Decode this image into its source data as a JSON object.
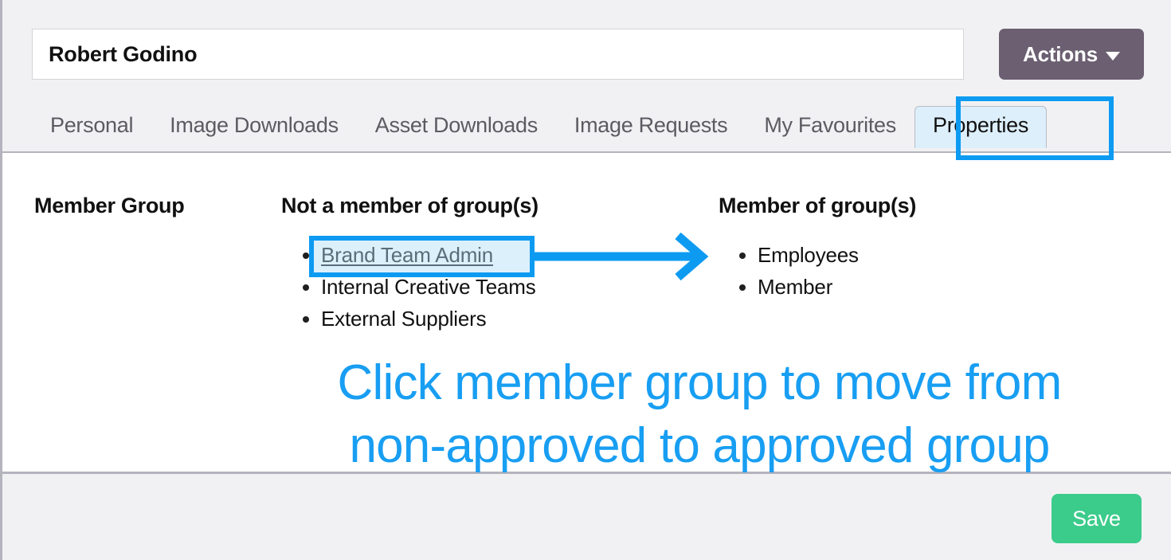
{
  "header": {
    "title_value": "Robert Godino",
    "title_placeholder": "Name",
    "actions_label": "Actions"
  },
  "tabs": [
    {
      "label": "Personal",
      "active": false
    },
    {
      "label": "Image Downloads",
      "active": false
    },
    {
      "label": "Asset Downloads",
      "active": false
    },
    {
      "label": "Image Requests",
      "active": false
    },
    {
      "label": "My Favourites",
      "active": false
    },
    {
      "label": "Properties",
      "active": true
    }
  ],
  "main": {
    "field_label": "Member Group",
    "not_member_heading": "Not a member of group(s)",
    "member_heading": "Member of group(s)",
    "not_member_groups": [
      "Brand Team Admin",
      "Internal Creative Teams",
      "External Suppliers"
    ],
    "member_groups": [
      "Employees",
      "Member"
    ]
  },
  "annotations": {
    "callout_line1": "Click member group to move from",
    "callout_line2": "non-approved to approved group",
    "highlight_color": "#0d9bf2",
    "callout_text_color": "#189ef2",
    "highlight_fill": "#dff1fb"
  },
  "footer": {
    "save_label": "Save",
    "save_color": "#3bcb8b"
  }
}
